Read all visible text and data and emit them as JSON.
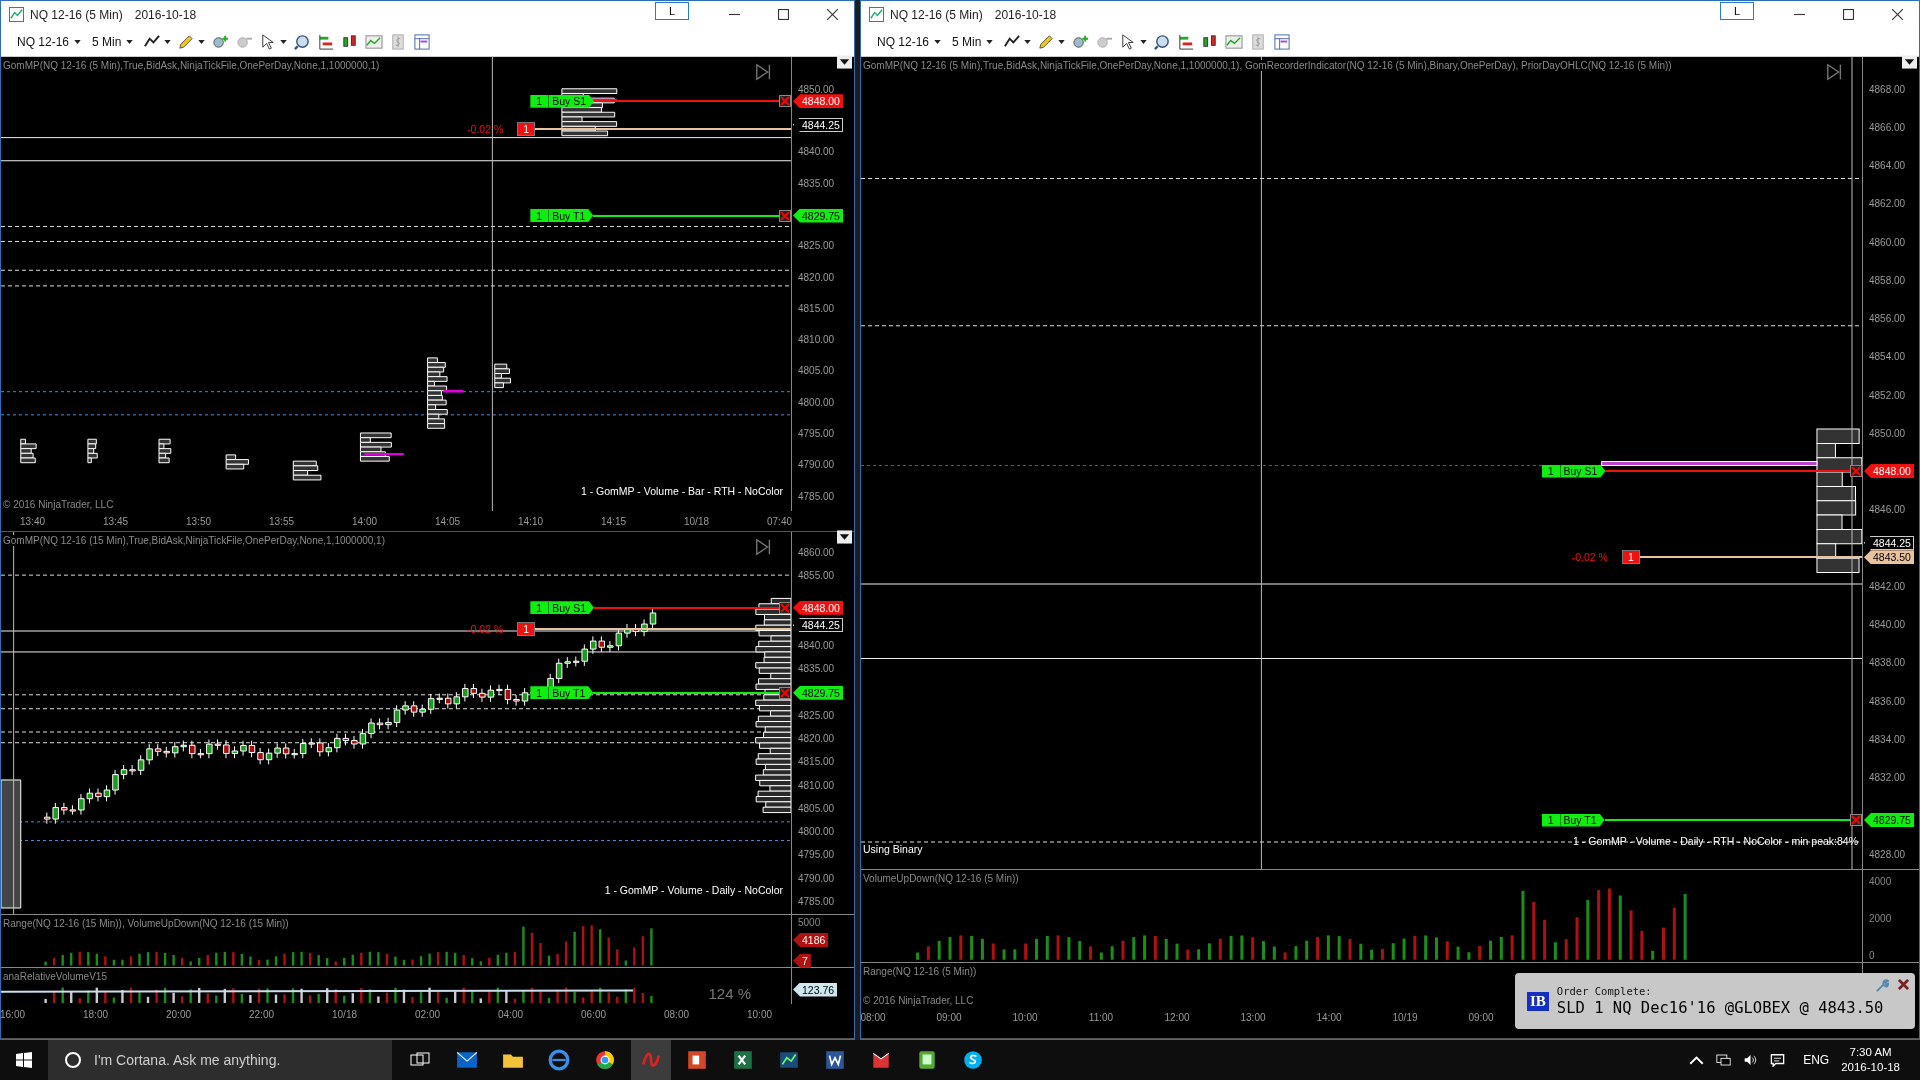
{
  "windows": [
    {
      "title": "NQ 12-16 (5 Min)",
      "date": "2016-10-18",
      "layout_button": "L",
      "instrument": "NQ 12-16",
      "interval": "5 Min",
      "panels": [
        {
          "kind": "profiles",
          "indicator": "GomMP(NQ 12-16 (5 Min),True,BidAsk,NinjaTickFile,OnePerDay,None,1,1000000,1)",
          "y_ticks": [
            "4850.00",
            "4840.00",
            "4835.00",
            "4825.00",
            "4820.00",
            "4815.00",
            "4810.00",
            "4805.00",
            "4800.00",
            "4795.00",
            "4790.00",
            "4785.00"
          ],
          "orders": [
            {
              "kind": "stop",
              "quantity": "1",
              "label": "Buy S1",
              "price": "4848.00"
            },
            {
              "kind": "target",
              "quantity": "1",
              "label": "Buy T1",
              "price": "4829.75"
            }
          ],
          "position": {
            "pnl": "-0.02 %",
            "quantity": "1"
          },
          "last_price": "4844.25",
          "footer": "1 - GomMP  - Volume - Bar - RTH - NoColor",
          "copyright": "© 2016 NinjaTrader, LLC",
          "x_ticks": [
            "13:40",
            "13:45",
            "13:50",
            "13:55",
            "14:00",
            "14:05",
            "14:10",
            "14:15",
            "10/18",
            "07:40"
          ]
        },
        {
          "kind": "candles",
          "indicator": "GomMP(NQ 12-16 (15 Min),True,BidAsk,NinjaTickFile,OnePerDay,None,1,1000000,1)",
          "y_ticks": [
            "4860.00",
            "4855.00",
            "4840.00",
            "4835.00",
            "4825.00",
            "4820.00",
            "4815.00",
            "4810.00",
            "4805.00",
            "4800.00",
            "4795.00",
            "4790.00",
            "4785.00"
          ],
          "orders": [
            {
              "kind": "stop",
              "quantity": "1",
              "label": "Buy S1",
              "price": "4848.00"
            },
            {
              "kind": "target",
              "quantity": "1",
              "label": "Buy T1",
              "price": "4829.75"
            }
          ],
          "position": {
            "pnl": "-0.02 %",
            "quantity": "1"
          },
          "last_price": "4844.25",
          "footer": "1 - GomMP - Volume - Daily - NoColor",
          "subpanels": [
            {
              "kind": "volume",
              "label": "Range(NQ 12-16 (15 Min)), VolumeUpDown(NQ 12-16 (15 Min))",
              "y_ticks": [
                "5000"
              ],
              "tags": [
                {
                  "kind": "down",
                  "text": "4186"
                },
                {
                  "kind": "down",
                  "text": "7"
                }
              ]
            },
            {
              "kind": "relative",
              "label": "anaRelativeVolumeV15",
              "reading": "124 %",
              "tags": [
                {
                  "kind": "neutral",
                  "text": "123.76"
                }
              ]
            }
          ],
          "x_ticks": [
            "16:00",
            "18:00",
            "20:00",
            "22:00",
            "10/18",
            "02:00",
            "04:00",
            "06:00",
            "08:00",
            "10:00"
          ]
        }
      ]
    },
    {
      "title": "NQ 12-16 (5 Min)",
      "date": "2016-10-18",
      "layout_button": "L",
      "instrument": "NQ 12-16",
      "interval": "5 Min",
      "panels": [
        {
          "kind": "profile_edge",
          "indicator": "GomMP(NQ 12-16 (5 Min),True,BidAsk,NinjaTickFile,OnePerDay,None,1,1000000,1), GomRecorderIndicator(NQ 12-16 (5 Min),Binary,OnePerDay), PriorDayOHLC(NQ 12-16 (5 Min))",
          "y_ticks": [
            "4868.00",
            "4866.00",
            "4864.00",
            "4862.00",
            "4860.00",
            "4858.00",
            "4856.00",
            "4854.00",
            "4852.00",
            "4850.00",
            "4846.00",
            "4842.00",
            "4840.00",
            "4838.00",
            "4836.00",
            "4834.00",
            "4832.00",
            "4828.00"
          ],
          "orders": [
            {
              "kind": "stop",
              "quantity": "1",
              "label": "Buy S1",
              "price": "4848.00"
            },
            {
              "kind": "target",
              "quantity": "1",
              "label": "Buy T1",
              "price": "4829.75"
            }
          ],
          "position": {
            "pnl": "-0.02 %",
            "quantity": "1",
            "price": "4843.50"
          },
          "last_price": "4844.25",
          "footer": "1 - GomMP - Volume - Daily - RTH - NoColor - min peak:84%",
          "note": "Using Binary",
          "subpanels": [
            {
              "kind": "volume",
              "label": "VolumeUpDown(NQ 12-16 (5 Min))",
              "y_ticks": [
                "4000",
                "2000",
                "0"
              ]
            },
            {
              "kind": "range",
              "label": "Range(NQ 12-16 (5 Min))",
              "copyright": "© 2016 NinjaTrader, LLC"
            }
          ],
          "x_ticks": [
            "08:00",
            "09:00",
            "10:00",
            "11:00",
            "12:00",
            "13:00",
            "14:00",
            "10/19",
            "09:00"
          ]
        }
      ]
    }
  ],
  "notification": {
    "logo": "IB",
    "title": "Order Complete:",
    "message": "SLD 1 NQ Dec16'16 @GLOBEX @ 4843.50"
  },
  "taskbar": {
    "search": {
      "placeholder": "I'm Cortana. Ask me anything."
    },
    "language": "ENG",
    "time": "7:30 AM",
    "date": "2016-10-18"
  }
}
